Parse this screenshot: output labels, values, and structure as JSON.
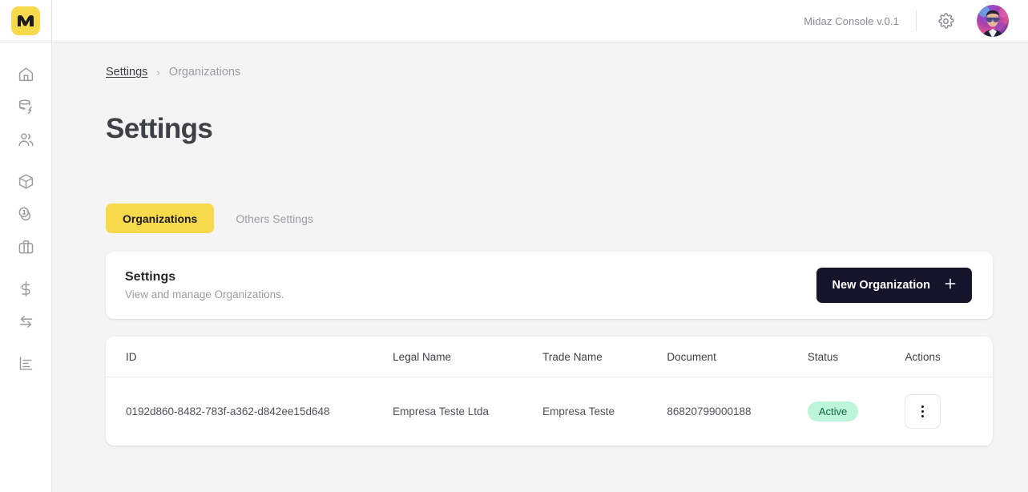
{
  "sidebar": {
    "logo_name": "midaz-logo",
    "logo_letter": "M",
    "brand_color": "#f7d94c",
    "items": [
      {
        "name": "home",
        "icon": "home-icon"
      },
      {
        "name": "ledgers",
        "icon": "database-lightning-icon"
      },
      {
        "name": "users",
        "icon": "users-icon"
      },
      {
        "name": "assets",
        "icon": "cube-icon"
      },
      {
        "name": "portfolios",
        "icon": "coins-icon"
      },
      {
        "name": "segments",
        "icon": "briefcase-icon"
      },
      {
        "name": "accounts",
        "icon": "dollar-icon"
      },
      {
        "name": "transactions",
        "icon": "arrows-exchange-icon"
      },
      {
        "name": "reports",
        "icon": "bar-chart-icon"
      }
    ]
  },
  "header": {
    "version_label": "Midaz Console v.0.1",
    "gear_icon": "gear-icon",
    "avatar_icon": "user-avatar"
  },
  "breadcrumb": {
    "parent": "Settings",
    "separator": "›",
    "current": "Organizations"
  },
  "page": {
    "title": "Settings"
  },
  "tabs": [
    {
      "label": "Organizations",
      "active": true
    },
    {
      "label": "Others Settings",
      "active": false
    }
  ],
  "settings_card": {
    "title": "Settings",
    "subtitle": "View and manage Organizations.",
    "button_label": "New Organization",
    "button_icon": "plus-icon",
    "button_color": "#14142b"
  },
  "table": {
    "columns": [
      "ID",
      "Legal Name",
      "Trade Name",
      "Document",
      "Status",
      "Actions"
    ],
    "rows": [
      {
        "id": "0192d860-8482-783f-a362-d842ee15d648",
        "legal_name": "Empresa Teste Ltda",
        "trade_name": "Empresa Teste",
        "document": "86820799000188",
        "status": "Active",
        "status_bg": "#bdf5da",
        "status_color": "#0b6b45",
        "actions_icon": "kebab-menu-icon"
      }
    ]
  }
}
